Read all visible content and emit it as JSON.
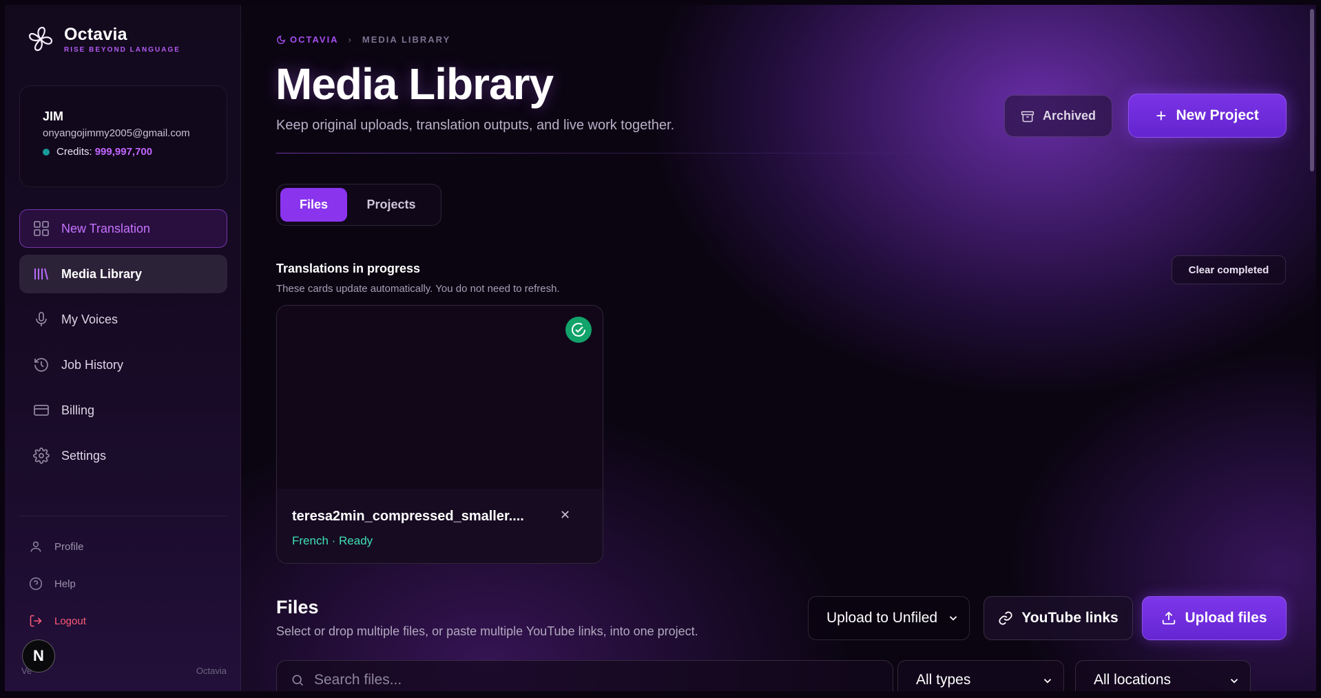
{
  "brand": {
    "name": "Octavia",
    "tagline": "RISE BEYOND LANGUAGE"
  },
  "user": {
    "name": "JIM",
    "email": "onyangojimmy2005@gmail.com",
    "credits_label": "Credits:",
    "credits_value": "999,997,700"
  },
  "nav": {
    "new_translation": "New Translation",
    "media_library": "Media Library",
    "my_voices": "My Voices",
    "job_history": "Job History",
    "billing": "Billing",
    "settings": "Settings"
  },
  "sub_nav": {
    "profile": "Profile",
    "help": "Help",
    "logout": "Logout"
  },
  "sidebar_footer": {
    "left": "Ve",
    "right": "Octavia"
  },
  "next_badge": "N",
  "breadcrumb": {
    "root": "OCTAVIA",
    "current": "MEDIA LIBRARY"
  },
  "header": {
    "title": "Media Library",
    "subtitle": "Keep original uploads, translation outputs, and live work together.",
    "archived_label": "Archived",
    "new_project_label": "New Project"
  },
  "tabs": {
    "files": "Files",
    "projects": "Projects",
    "active": "Files"
  },
  "in_progress": {
    "title": "Translations in progress",
    "subtitle": "These cards update automatically. You do not need to refresh.",
    "clear_label": "Clear completed",
    "cards": [
      {
        "name": "teresa2min_compressed_smaller....",
        "status": "French · Ready"
      }
    ]
  },
  "files": {
    "title": "Files",
    "subtitle": "Select or drop multiple files, or paste multiple YouTube links, into one project.",
    "upload_to_label": "Upload to Unfiled",
    "youtube_label": "YouTube links",
    "upload_label": "Upload files",
    "search_placeholder": "Search files...",
    "type_filter": "All types",
    "location_filter": "All locations"
  },
  "colors": {
    "accent": "#8a34ee",
    "accent_text": "#c266ff",
    "ready_status": "#3fe0b4",
    "success": "#12a36b",
    "logout": "#ff5a7a"
  }
}
